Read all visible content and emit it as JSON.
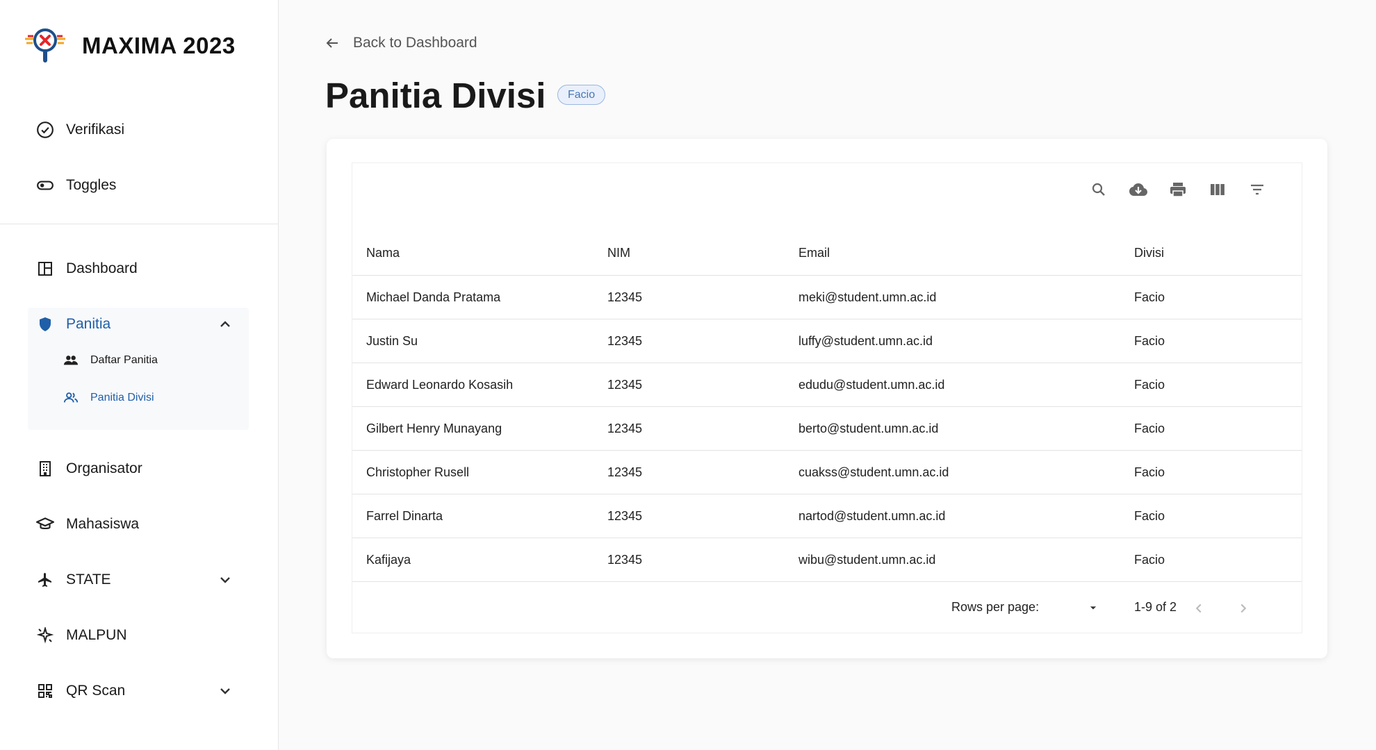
{
  "brand": {
    "title": "MAXIMA 2023"
  },
  "sidebar": {
    "top_items": [
      {
        "label": "Verifikasi",
        "icon": "check-circle-icon"
      },
      {
        "label": "Toggles",
        "icon": "toggle-icon"
      }
    ],
    "items": [
      {
        "label": "Dashboard",
        "icon": "dashboard-icon"
      },
      {
        "label": "Panitia",
        "icon": "shield-icon",
        "expanded": true
      },
      {
        "label": "Organisator",
        "icon": "building-icon"
      },
      {
        "label": "Mahasiswa",
        "icon": "graduation-cap-icon"
      },
      {
        "label": "STATE",
        "icon": "airplane-icon"
      },
      {
        "label": "MALPUN",
        "icon": "sparkle-icon"
      },
      {
        "label": "QR Scan",
        "icon": "qr-code-icon"
      }
    ],
    "panitia_sub": [
      {
        "label": "Daftar Panitia",
        "icon": "people-icon"
      },
      {
        "label": "Panitia Divisi",
        "icon": "people-outline-icon",
        "active": true
      }
    ]
  },
  "main": {
    "back_label": "Back to Dashboard",
    "title": "Panitia Divisi",
    "badge": "Facio"
  },
  "table": {
    "columns": [
      "Nama",
      "NIM",
      "Email",
      "Divisi"
    ],
    "rows": [
      [
        "Michael Danda Pratama",
        "12345",
        "meki@student.umn.ac.id",
        "Facio"
      ],
      [
        "Justin Su",
        "12345",
        "luffy@student.umn.ac.id",
        "Facio"
      ],
      [
        "Edward Leonardo Kosasih",
        "12345",
        "edudu@student.umn.ac.id",
        "Facio"
      ],
      [
        "Gilbert Henry Munayang",
        "12345",
        "berto@student.umn.ac.id",
        "Facio"
      ],
      [
        "Christopher Rusell",
        "12345",
        "cuakss@student.umn.ac.id",
        "Facio"
      ],
      [
        "Farrel Dinarta",
        "12345",
        "nartod@student.umn.ac.id",
        "Facio"
      ],
      [
        "Kafijaya",
        "12345",
        "wibu@student.umn.ac.id",
        "Facio"
      ]
    ],
    "toolbar_icons": [
      "search-icon",
      "download-icon",
      "print-icon",
      "columns-icon",
      "filter-icon"
    ],
    "footer": {
      "rows_per_page_label": "Rows per page:",
      "range": "1-9 of 2"
    }
  },
  "colors": {
    "accent": "#1f5fa8",
    "badge_bg": "#e9f0fb",
    "badge_border": "#9ab7df"
  }
}
